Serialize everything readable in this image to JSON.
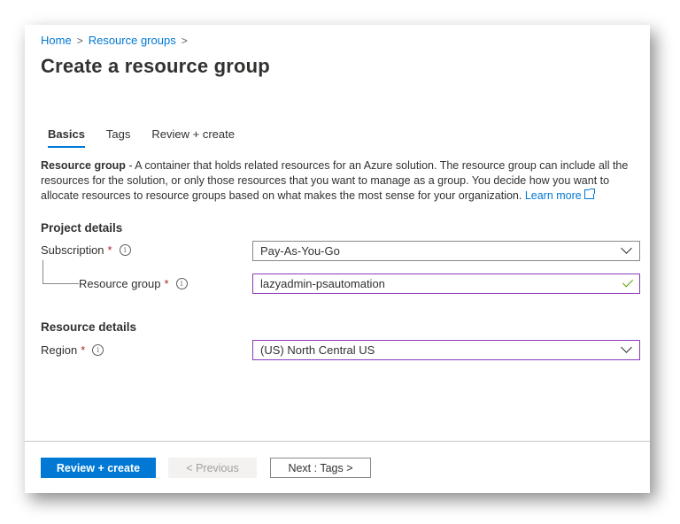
{
  "breadcrumb": {
    "home": "Home",
    "resource_groups": "Resource groups",
    "separator": ">"
  },
  "page": {
    "title": "Create a resource group"
  },
  "tabs": [
    {
      "label": "Basics",
      "active": true
    },
    {
      "label": "Tags",
      "active": false
    },
    {
      "label": "Review + create",
      "active": false
    }
  ],
  "description": {
    "bold": "Resource group",
    "text": " - A container that holds related resources for an Azure solution. The resource group can include all the resources for the solution, or only those resources that you want to manage as a group. You decide how you want to allocate resources to resource groups based on what makes the most sense for your organization. ",
    "learn_more": "Learn more"
  },
  "project_details": {
    "heading": "Project details",
    "subscription": {
      "label": "Subscription",
      "required_mark": "*",
      "value": "Pay-As-You-Go"
    },
    "resource_group": {
      "label": "Resource group",
      "required_mark": "*",
      "value": "lazyadmin-psautomation"
    }
  },
  "resource_details": {
    "heading": "Resource details",
    "region": {
      "label": "Region",
      "required_mark": "*",
      "value": "(US) North Central US"
    }
  },
  "footer": {
    "review_create": "Review + create",
    "previous": "< Previous",
    "next": "Next : Tags >"
  },
  "icons": {
    "info": "info-icon",
    "external": "external-link-icon",
    "chevron": "chevron-down-icon",
    "check": "checkmark-icon"
  },
  "colors": {
    "accent": "#0078d4",
    "focus_border": "#8a3ab9",
    "required": "#a4262c",
    "valid": "#57a300"
  }
}
